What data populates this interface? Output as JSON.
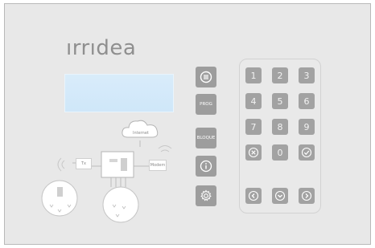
{
  "brand": {
    "logo_text": "ırrıdea"
  },
  "display": {
    "text": ""
  },
  "side_buttons": [
    {
      "label": "",
      "icon": "menu-icon"
    },
    {
      "label": "PROG",
      "icon": ""
    },
    {
      "label": "BLOQUE",
      "icon": ""
    },
    {
      "label": "",
      "icon": "info-icon"
    },
    {
      "label": "",
      "icon": "gear-icon"
    }
  ],
  "keypad": {
    "digits": [
      "1",
      "2",
      "3",
      "4",
      "5",
      "6",
      "7",
      "8",
      "9"
    ],
    "zero": "0",
    "cancel_icon": "cancel-icon",
    "confirm_icon": "check-icon",
    "nav_icons": [
      "arrow-left-icon",
      "arrow-down-icon",
      "arrow-right-icon"
    ]
  },
  "diagram": {
    "cloud_label": "Internet",
    "tx_label": "Tx",
    "modem_label": "Modem"
  },
  "colors": {
    "panel": "#e8e8e8",
    "button": "#9d9d9d",
    "lcd": "#d3e8f9"
  }
}
